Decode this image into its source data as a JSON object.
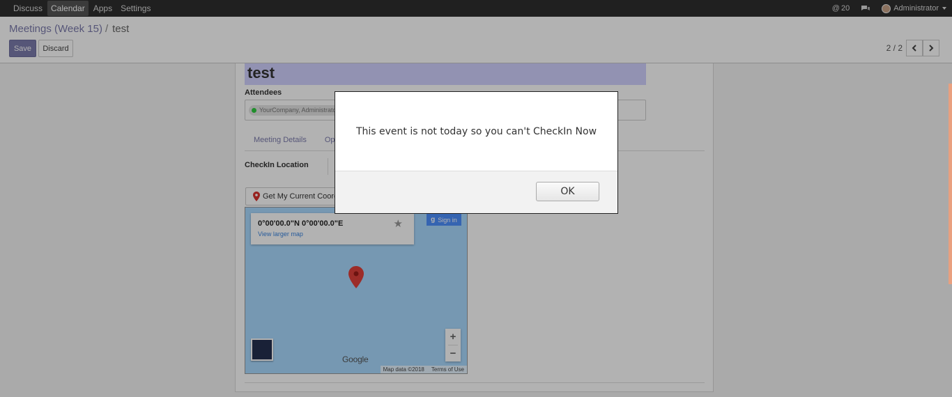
{
  "topbar": {
    "menu": [
      "Discuss",
      "Calendar",
      "Apps",
      "Settings"
    ],
    "active_menu": "Calendar",
    "mentions_count": "20",
    "user": "Administrator"
  },
  "breadcrumb": {
    "parent": "Meetings (Week 15)",
    "separator": "/",
    "current": "test"
  },
  "buttons": {
    "save": "Save",
    "discard": "Discard"
  },
  "pager": {
    "value": "2 / 2"
  },
  "form": {
    "title": "test",
    "attendees_label": "Attendees",
    "attendee_tag": "YourCompany, Administrator",
    "tabs": [
      "Meeting Details",
      "Opt"
    ],
    "checkin_label": "CheckIn Location",
    "coords_button": "Get My Current Coordinates"
  },
  "map": {
    "coords": "0°00'00.0\"N 0°00'00.0\"E",
    "view_larger": "View larger map",
    "sign_in": "Sign in",
    "google": "Google",
    "map_data": "Map data ©2018",
    "terms": "Terms of Use"
  },
  "dialog": {
    "message": "This event is not today so you can't CheckIn Now",
    "ok": "OK"
  },
  "colors": {
    "accent": "#7c7bad",
    "title_bg": "#d2d2ff",
    "navbar": "#2f2f2f",
    "map_water": "#aadaff"
  }
}
